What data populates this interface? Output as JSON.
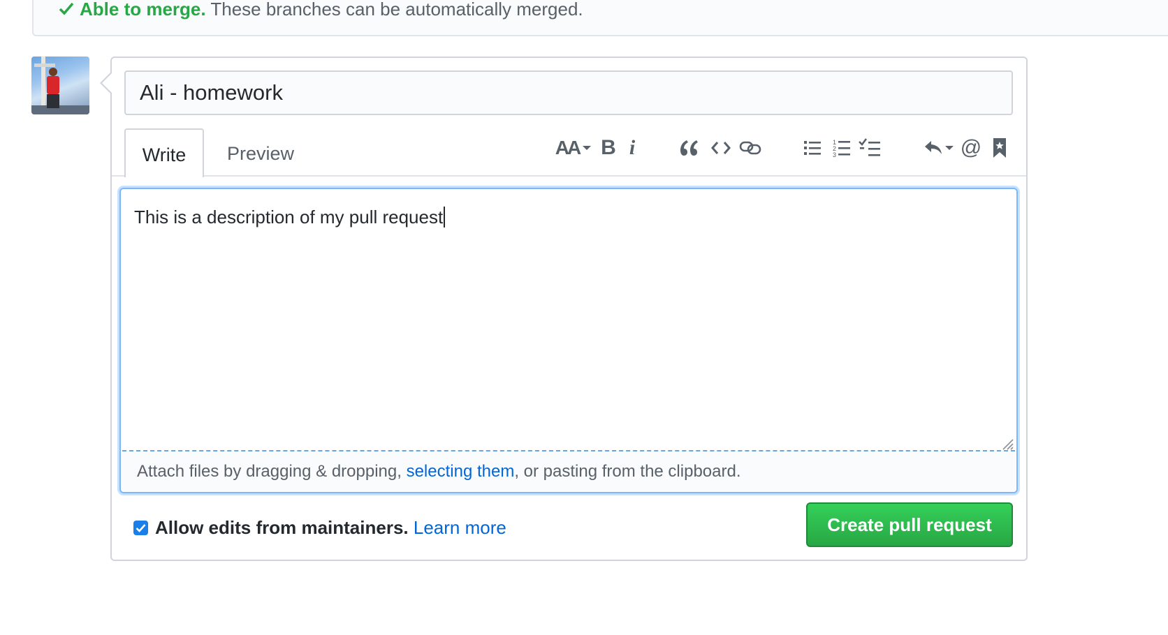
{
  "merge_status": {
    "status_label": "Able to merge.",
    "message": " These branches can be automatically merged."
  },
  "form": {
    "title_value": "Ali - homework",
    "tabs": [
      {
        "label": "Write",
        "active": true
      },
      {
        "label": "Preview",
        "active": false
      }
    ],
    "toolbar": {
      "header_icon_text": "AA",
      "bold_icon_text": "B",
      "italic_icon_text": "i",
      "icons": [
        "text-size-icon",
        "bold-icon",
        "italic-icon",
        "quote-icon",
        "code-icon",
        "link-icon",
        "unordered-list-icon",
        "ordered-list-icon",
        "task-list-icon",
        "reply-icon",
        "mention-icon",
        "bookmark-icon"
      ]
    },
    "body_value": "This is a description of my pull request",
    "attach": {
      "before": "Attach files by dragging & dropping, ",
      "link": "selecting them",
      "after": ", or pasting from the clipboard."
    },
    "allow_edits": {
      "checked": true,
      "label": "Allow edits from maintainers.",
      "learn_more": "Learn more"
    },
    "submit_label": "Create pull request"
  },
  "colors": {
    "success": "#28a745",
    "link": "#0366d6",
    "focus": "#79b8ff"
  }
}
